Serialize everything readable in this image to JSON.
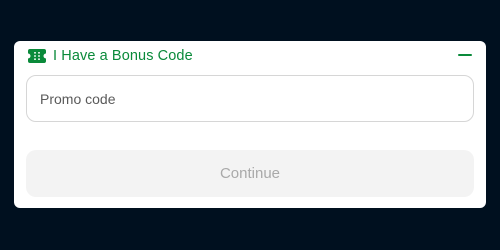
{
  "bonus_panel": {
    "title": "I Have a Bonus Code",
    "title_icon": "ticket-icon",
    "collapse_icon": "minus-icon",
    "promo_input": {
      "placeholder": "Promo code",
      "value": ""
    },
    "continue_label": "Continue",
    "continue_disabled": true
  },
  "colors": {
    "background": "#00101f",
    "accent": "#0a8a3a",
    "card": "#ffffff",
    "button_disabled_bg": "#f3f3f3",
    "button_disabled_text": "#a9a9a9"
  }
}
